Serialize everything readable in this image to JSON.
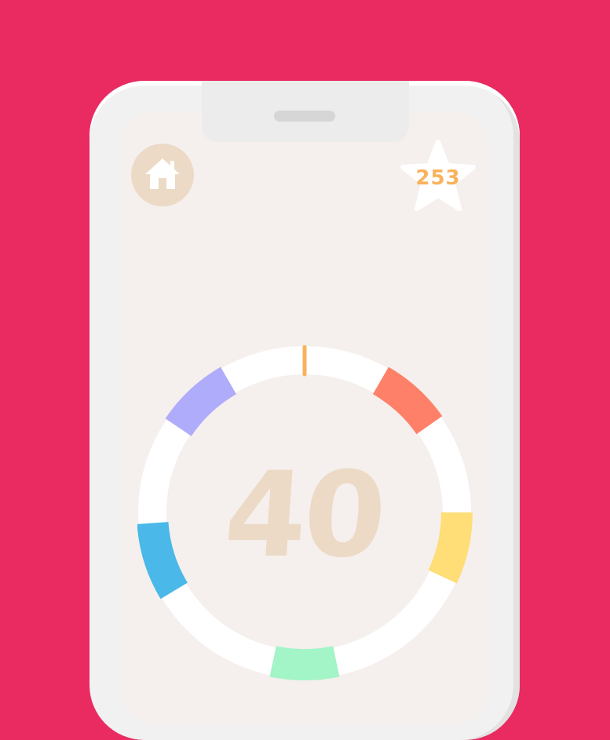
{
  "game": {
    "score": "40",
    "stars": "253",
    "current_color": "#f9b25c"
  },
  "icons": {
    "home": "home-icon",
    "star": "star-icon"
  },
  "ring": {
    "segments": [
      {
        "color": "#ff8068",
        "start_deg": 30,
        "end_deg": 55
      },
      {
        "color": "#ffdd77",
        "start_deg": 90,
        "end_deg": 115
      },
      {
        "color": "#a3f4c7",
        "start_deg": 168,
        "end_deg": 192
      },
      {
        "color": "#4ab8e8",
        "start_deg": 239,
        "end_deg": 266
      },
      {
        "color": "#b0acfc",
        "start_deg": 304,
        "end_deg": 330
      }
    ]
  },
  "colors": {
    "background": "#e92b62",
    "screen": "#f5f0ed",
    "accent": "#ecdac6",
    "star_text": "#f9b25c"
  }
}
